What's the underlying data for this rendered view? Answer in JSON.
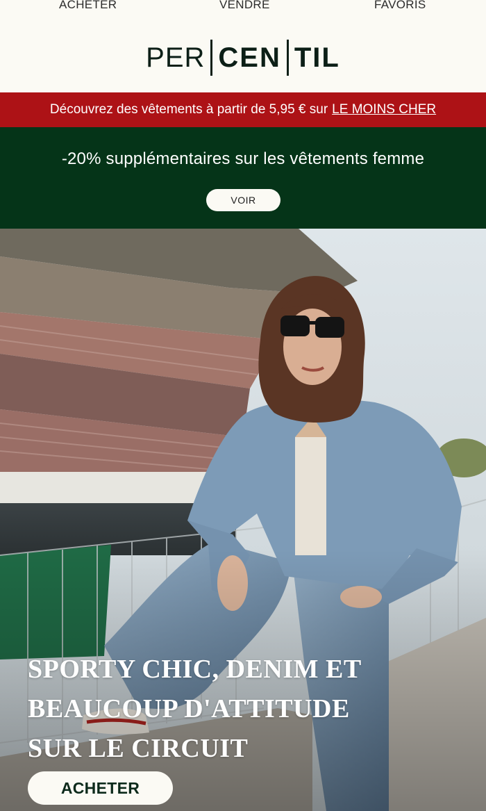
{
  "nav": {
    "items": [
      {
        "label": "ACHETER"
      },
      {
        "label": "VENDRE"
      },
      {
        "label": "FAVORIS"
      }
    ]
  },
  "brand": {
    "segments": [
      "PER",
      "CEN",
      "TIL"
    ]
  },
  "promo_banner": {
    "text": "Découvrez des vêtements à partir de 5,95 € sur",
    "link_label": "LE MOINS CHER"
  },
  "offer": {
    "headline": "-20% supplémentaires sur les vêtements femme",
    "button_label": "VOIR"
  },
  "hero": {
    "title_lines": [
      "SPORTY CHIC, DENIM ET",
      "BEAUCOUP D'ATTITUDE",
      "SUR LE CIRCUIT"
    ],
    "button_label": "ACHETER"
  },
  "colors": {
    "background": "#fbfaf4",
    "brand_dark": "#0c1f17",
    "banner_red": "#ad1216",
    "offer_green": "#053418"
  }
}
